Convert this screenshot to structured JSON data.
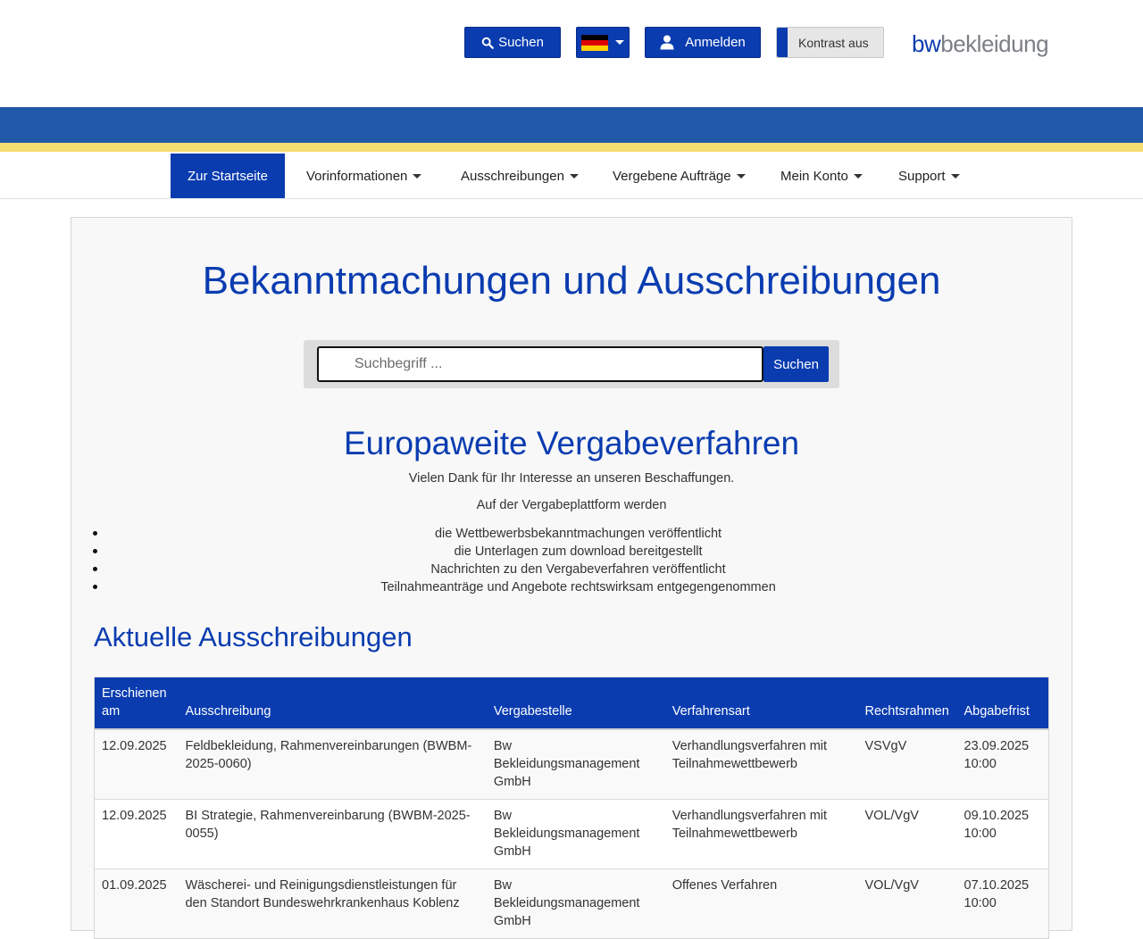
{
  "header": {
    "search_label": "Suchen",
    "login_label": "Anmelden",
    "contrast_label": "Kontrast aus",
    "logo_bw": "bw",
    "logo_rest": "bekleidung",
    "flag_colors": [
      "#000000",
      "#dd0000",
      "#ffce00"
    ]
  },
  "nav": {
    "items": [
      {
        "label": "Zur Startseite"
      },
      {
        "label": "Vorinformationen"
      },
      {
        "label": "Ausschreibungen"
      },
      {
        "label": "Vergebene Aufträge"
      },
      {
        "label": "Mein Konto"
      },
      {
        "label": "Support"
      }
    ]
  },
  "main": {
    "title": "Bekanntmachungen und Ausschreibungen",
    "search_placeholder": "Suchbegriff ...",
    "search_button": "Suchen",
    "subtitle": "Europaweite Vergabeverfahren",
    "intro1": "Vielen Dank für Ihr Interesse an unseren Beschaffungen.",
    "intro2": "Auf der Vergabeplattform werden",
    "bullets": [
      "die Wettbewerbsbekanntmachungen veröffentlicht",
      "die Unterlagen zum download bereitgestellt",
      "Nachrichten zu den Vergabeverfahren veröffentlicht",
      "Teilnahmeanträge und Angebote rechtswirksam entgegengenommen"
    ],
    "current_title": "Aktuelle Ausschreibungen"
  },
  "table": {
    "headers": [
      "Erschienen am",
      "Ausschreibung",
      "Vergabestelle",
      "Verfahrensart",
      "Rechtsrahmen",
      "Abgabefrist"
    ],
    "rows": [
      [
        "12.09.2025",
        "Feldbekleidung, Rahmenvereinbarungen (BWBM-2025-0060)",
        "Bw Bekleidungsmanagement GmbH",
        "Verhandlungsverfahren mit Teilnahmewettbewerb",
        "VSVgV",
        "23.09.2025 10:00"
      ],
      [
        "12.09.2025",
        "BI Strategie, Rahmenvereinbarung (BWBM-2025-0055)",
        "Bw Bekleidungsmanagement GmbH",
        "Verhandlungsverfahren mit Teilnahmewettbewerb",
        "VOL/VgV",
        "09.10.2025 10:00"
      ],
      [
        "01.09.2025",
        "Wäscherei- und Reinigungsdienstleistungen für den Standort Bundeswehrkrankenhaus Koblenz",
        "Bw Bekleidungsmanagement GmbH",
        "Offenes Verfahren",
        "VOL/VgV",
        "07.10.2025 10:00"
      ]
    ]
  },
  "colors": {
    "primary": "#0a3cb0",
    "band_blue": "#2159a8",
    "band_yellow": "#f7dc72"
  }
}
